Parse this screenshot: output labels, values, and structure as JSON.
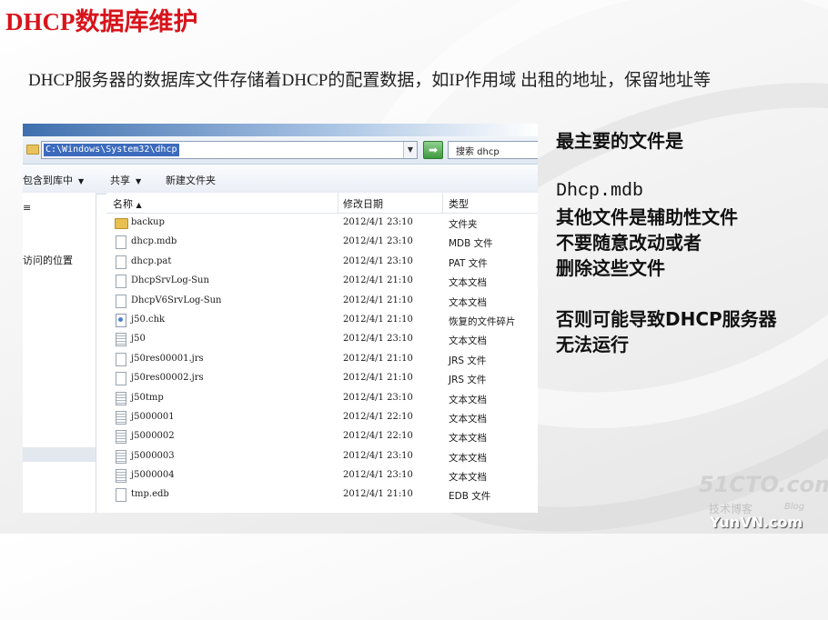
{
  "slide": {
    "title": "DHCP数据库维护",
    "intro": "DHCP服务器的数据库文件存储着DHCP的配置数据，如IP作用域 出租的地址，保留地址等"
  },
  "explorer": {
    "address": "C:\\Windows\\System32\\dhcp",
    "search_placeholder": "搜索 dhcp",
    "toolbar": {
      "include_library": "包含到库中",
      "share": "共享",
      "new_folder": "新建文件夹"
    },
    "nav": {
      "recent_places": "访问的位置"
    },
    "columns": {
      "name": "名称",
      "modified": "修改日期",
      "type": "类型"
    },
    "files": [
      {
        "name": "backup",
        "modified": "2012/4/1 23:10",
        "type": "文件夹",
        "icon": "folder-icon"
      },
      {
        "name": "dhcp.mdb",
        "modified": "2012/4/1 23:10",
        "type": "MDB 文件",
        "icon": "file-icon"
      },
      {
        "name": "dhcp.pat",
        "modified": "2012/4/1 23:10",
        "type": "PAT 文件",
        "icon": "file-icon"
      },
      {
        "name": "DhcpSrvLog-Sun",
        "modified": "2012/4/1 21:10",
        "type": "文本文档",
        "icon": "file-icon"
      },
      {
        "name": "DhcpV6SrvLog-Sun",
        "modified": "2012/4/1 21:10",
        "type": "文本文档",
        "icon": "file-icon"
      },
      {
        "name": "j50.chk",
        "modified": "2012/4/1 21:10",
        "type": "恢复的文件碎片",
        "icon": "chk-file-icon"
      },
      {
        "name": "j50",
        "modified": "2012/4/1 23:10",
        "type": "文本文档",
        "icon": "text-file-icon"
      },
      {
        "name": "j50res00001.jrs",
        "modified": "2012/4/1 21:10",
        "type": "JRS 文件",
        "icon": "file-icon"
      },
      {
        "name": "j50res00002.jrs",
        "modified": "2012/4/1 21:10",
        "type": "JRS 文件",
        "icon": "file-icon"
      },
      {
        "name": "j50tmp",
        "modified": "2012/4/1 23:10",
        "type": "文本文档",
        "icon": "text-file-icon"
      },
      {
        "name": "j5000001",
        "modified": "2012/4/1 22:10",
        "type": "文本文档",
        "icon": "text-file-icon"
      },
      {
        "name": "j5000002",
        "modified": "2012/4/1 22:10",
        "type": "文本文档",
        "icon": "text-file-icon"
      },
      {
        "name": "j5000003",
        "modified": "2012/4/1 23:10",
        "type": "文本文档",
        "icon": "text-file-icon"
      },
      {
        "name": "j5000004",
        "modified": "2012/4/1 23:10",
        "type": "文本文档",
        "icon": "text-file-icon"
      },
      {
        "name": "tmp.edb",
        "modified": "2012/4/1 21:10",
        "type": "EDB 文件",
        "icon": "file-icon"
      }
    ]
  },
  "side_note": {
    "lines": [
      "最主要的文件是",
      "",
      "Dhcp.mdb",
      "其他文件是辅助性文件",
      "不要随意改动或者",
      "删除这些文件",
      "",
      "否则可能导致DHCP服务器",
      "无法运行"
    ]
  },
  "watermarks": {
    "site": "51CTO.com",
    "blog_cn": "技术博客",
    "blog_en": "Blog",
    "yunvn": "YunVN.com"
  },
  "colors": {
    "title": "#d8141c",
    "address_selection": "#3c6bbd"
  }
}
